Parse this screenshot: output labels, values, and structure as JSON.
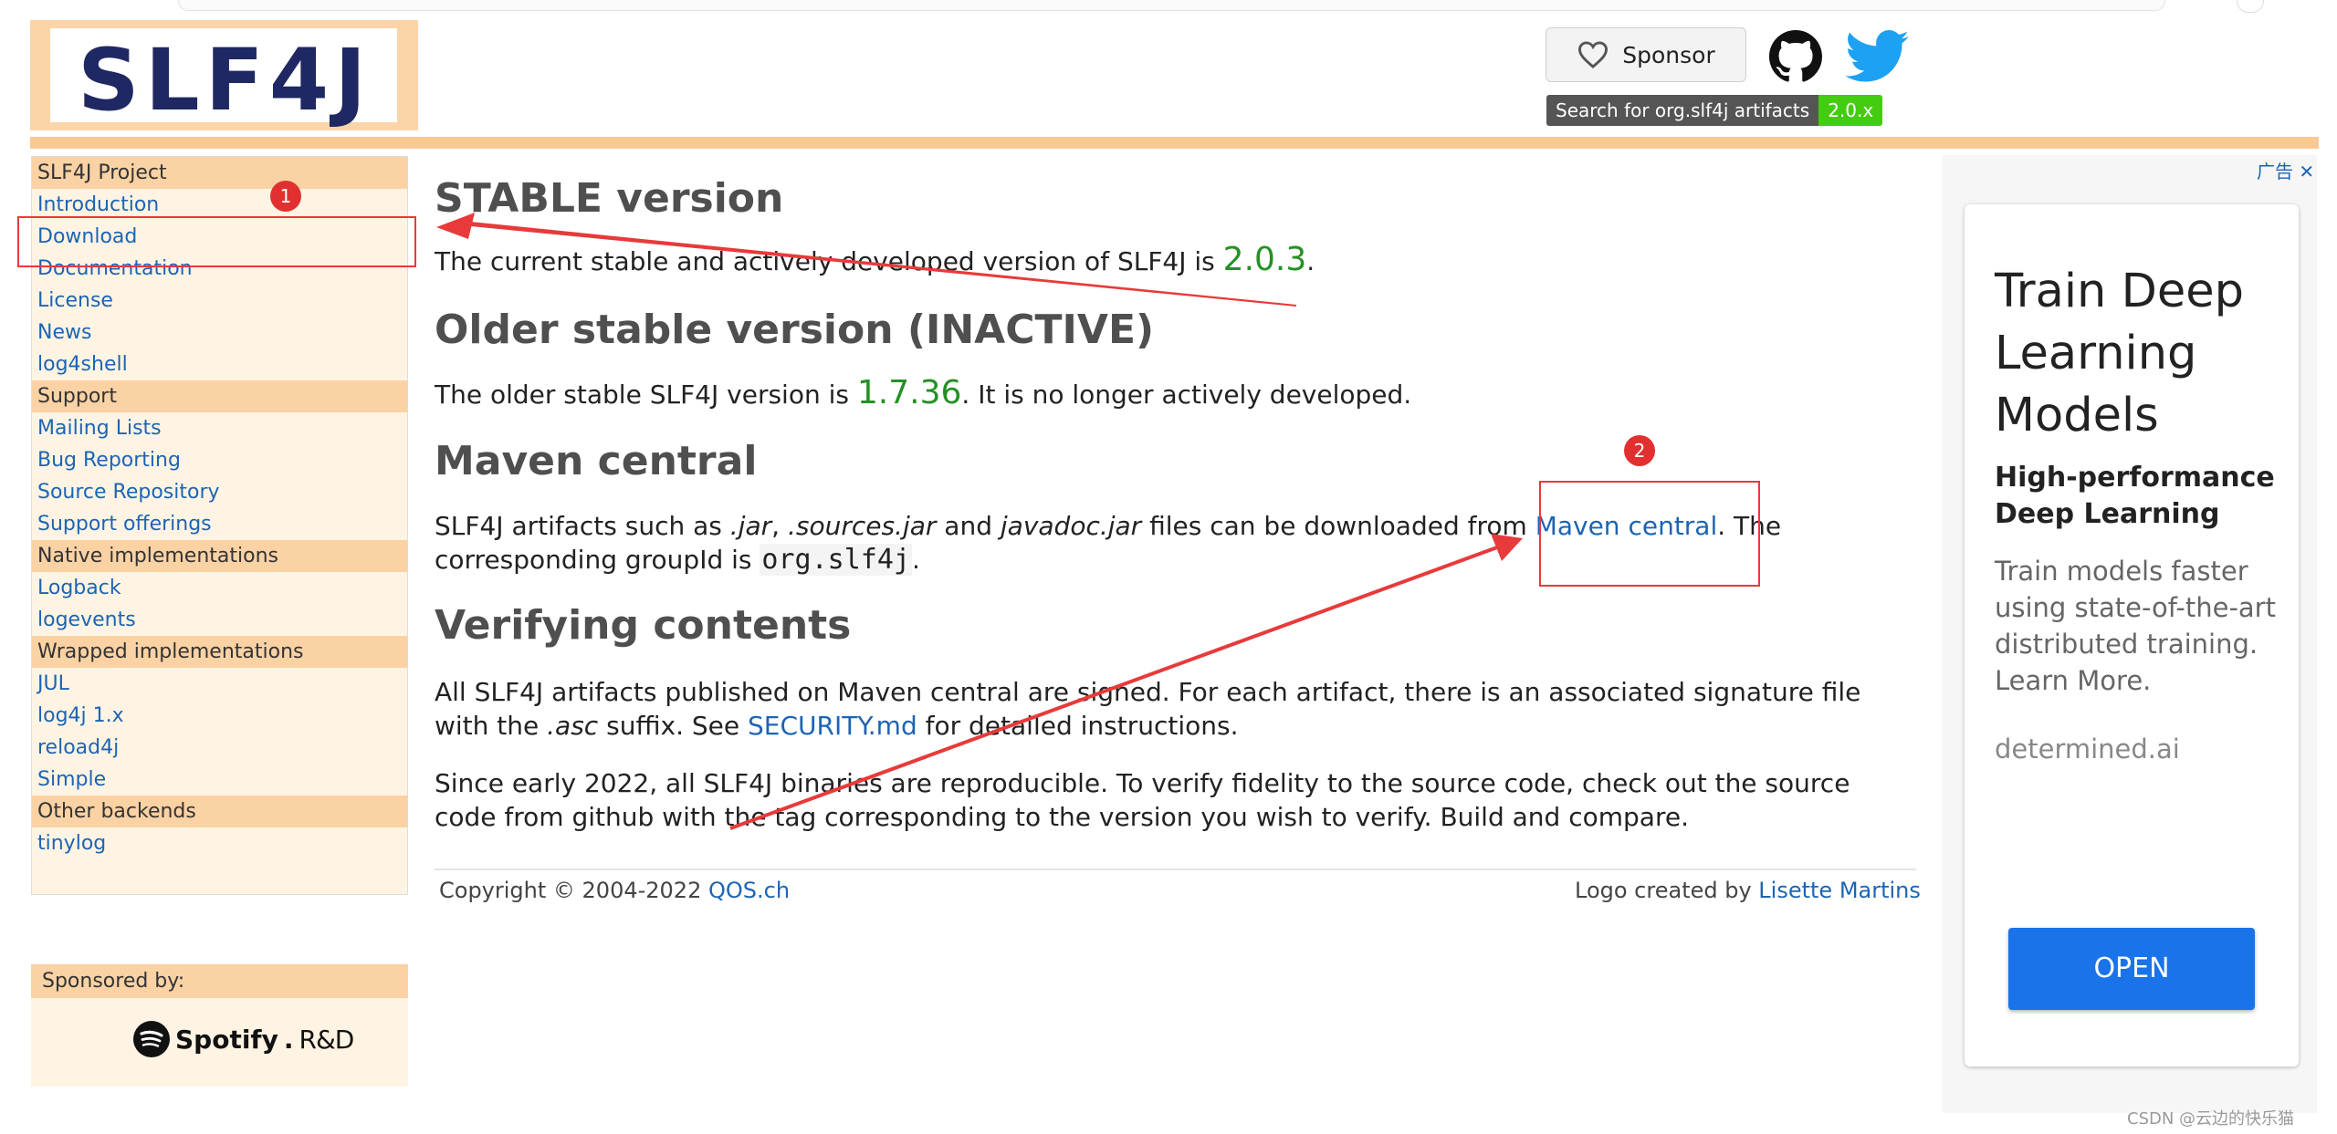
{
  "header": {
    "logo_text": "SLF4J",
    "sponsor_label": "Sponsor",
    "search_badge_left": "Search for org.slf4j artifacts",
    "search_badge_right": "2.0.x"
  },
  "menu": {
    "sections": [
      {
        "head": "SLF4J Project",
        "items": [
          "Introduction",
          "Download",
          "Documentation",
          "License",
          "News",
          "log4shell"
        ]
      },
      {
        "head": "Support",
        "items": [
          "Mailing Lists",
          "Bug Reporting",
          "Source Repository",
          "Support offerings"
        ]
      },
      {
        "head": "Native implementations",
        "items": [
          "Logback",
          "logevents"
        ]
      },
      {
        "head": "Wrapped implementations",
        "items": [
          "JUL",
          "log4j 1.x",
          "reload4j",
          "Simple"
        ]
      },
      {
        "head": "Other backends",
        "items": [
          "tinylog"
        ]
      }
    ]
  },
  "sponsored": {
    "head": "Sponsored by:",
    "brand": "Spotify",
    "brand_suffix": "R&D"
  },
  "main": {
    "stable_heading": "STABLE version",
    "stable_text_a": "The current stable and actively developed version of SLF4J is ",
    "stable_version": "2.0.3",
    "stable_text_b": ".",
    "older_heading": "Older stable version (INACTIVE)",
    "older_text_a": "The older stable SLF4J version is ",
    "older_version": "1.7.36",
    "older_text_b": ". It is no longer actively developed.",
    "maven_heading": "Maven central",
    "maven_text_a": "SLF4J artifacts such as ",
    "maven_jar": ".jar",
    "maven_comma": ", ",
    "maven_sources": ".sources.jar",
    "maven_and": " and ",
    "maven_javadoc": "javadoc.jar",
    "maven_text_b": " files can be downloaded from ",
    "maven_link": "Maven central",
    "maven_text_c": ". The corresponding groupId is ",
    "maven_group": "org.slf4j",
    "maven_text_d": ".",
    "verify_heading": "Verifying contents",
    "verify_p1_a": "All SLF4J artifacts published on Maven central are signed. For each artifact, there is an associated signature file with the ",
    "verify_p1_asc": ".asc",
    "verify_p1_b": " suffix. See ",
    "verify_p1_link": "SECURITY.md",
    "verify_p1_c": " for detailed instructions.",
    "verify_p2": "Since early 2022, all SLF4J binaries are reproducible. To verify fidelity to the source code, check out the source code from github with the tag corresponding to the version you wish to verify. Build and compare."
  },
  "footer": {
    "copyright": "Copyright © 2004-2022 ",
    "copyright_link": "QOS.ch",
    "logo_credit": "Logo created by ",
    "logo_credit_link": "Lisette Martins"
  },
  "annotations": {
    "marker_1": "1",
    "marker_2": "2",
    "accent": "#e83a3a"
  },
  "ad": {
    "label": "广告",
    "title": "Train Deep Learning Models",
    "subtitle": "High-performance Deep Learning",
    "body": "Train models faster using state-of-the-art distributed training. Learn More.",
    "domain": "determined.ai",
    "cta": "OPEN"
  },
  "watermark": "CSDN @云边的快乐猫"
}
